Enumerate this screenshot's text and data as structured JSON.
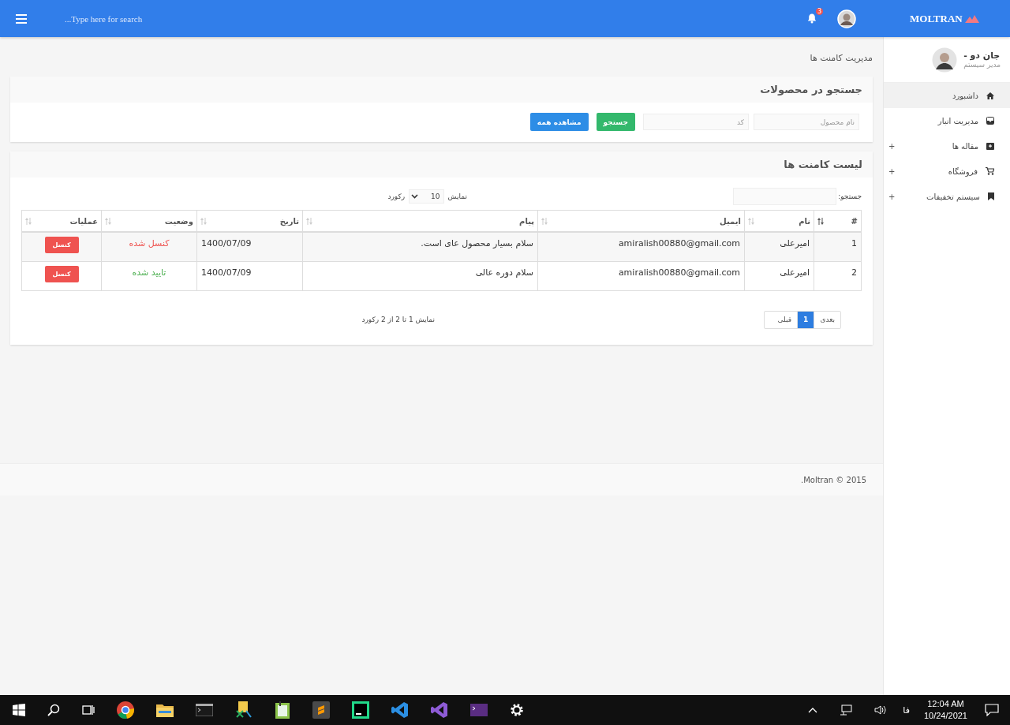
{
  "topbar": {
    "brand": "MOLTRAN",
    "search": {
      "placeholder": "...Type here for search"
    },
    "notifications": "3"
  },
  "sidebar": {
    "user": {
      "name": "جان دو -",
      "role": "مدیر سیستم"
    },
    "items": [
      {
        "label": "داشبورد",
        "kind": "home",
        "selected": true
      },
      {
        "label": "مدیریت انبار",
        "kind": "inbox",
        "selected": false
      },
      {
        "label": "مقاله ها",
        "kind": "box",
        "selected": false,
        "toggle": "+"
      },
      {
        "label": "فروشگاه",
        "kind": "cart",
        "selected": false,
        "toggle": "+"
      },
      {
        "label": "سیستم تخفیفات",
        "kind": "bookmark",
        "selected": false,
        "toggle": "+"
      }
    ]
  },
  "breadcrumb": "مدیریت کامنت ها",
  "search_card": {
    "title": "جستجو در محصولات",
    "fields": [
      {
        "placeholder": "نام محصول"
      },
      {
        "placeholder": "کد"
      }
    ],
    "buttons": [
      {
        "label": "جستجو",
        "kind": "success"
      },
      {
        "label": "مشاهده همه",
        "kind": "primary"
      }
    ]
  },
  "comments_card": {
    "title": "لیست کامنت ها",
    "filter_label": "جستجو:",
    "length": {
      "before": "نمایش",
      "value": "10",
      "after": "رکورد"
    },
    "columns": [
      {
        "label": "#",
        "sorted": true
      },
      {
        "label": "نام",
        "sorted": false
      },
      {
        "label": "ایمیل",
        "sorted": false
      },
      {
        "label": "پیام",
        "sorted": false
      },
      {
        "label": "تاریخ",
        "sorted": false
      },
      {
        "label": "وضعیت",
        "sorted": false
      },
      {
        "label": "عملیات",
        "sorted": false
      }
    ],
    "rows": [
      {
        "id": "1",
        "name": "امیرعلی",
        "email": "amiralish00880@gmail.com",
        "message": "سلام بسیار محصول عای است.",
        "date": "1400/07/09",
        "status": "کنسل شده",
        "kind": "cancelled",
        "action": "کنسل"
      },
      {
        "id": "2",
        "name": "امیرعلی",
        "email": "amiralish00880@gmail.com",
        "message": "سلام دوره عالی",
        "date": "1400/07/09",
        "status": "تایید شده",
        "kind": "approved",
        "action": "کنسل"
      }
    ],
    "info": "نمایش 1 تا 2 از 2 رکورد",
    "pages": [
      {
        "label": "بعدی",
        "selected": false
      },
      {
        "label": "1",
        "selected": true
      },
      {
        "label": "قبلی",
        "selected": false
      }
    ]
  },
  "footer": ".Moltran © 2015",
  "taskbar": {
    "language": "فا",
    "time": "12:04 AM",
    "date": "10/24/2021"
  }
}
